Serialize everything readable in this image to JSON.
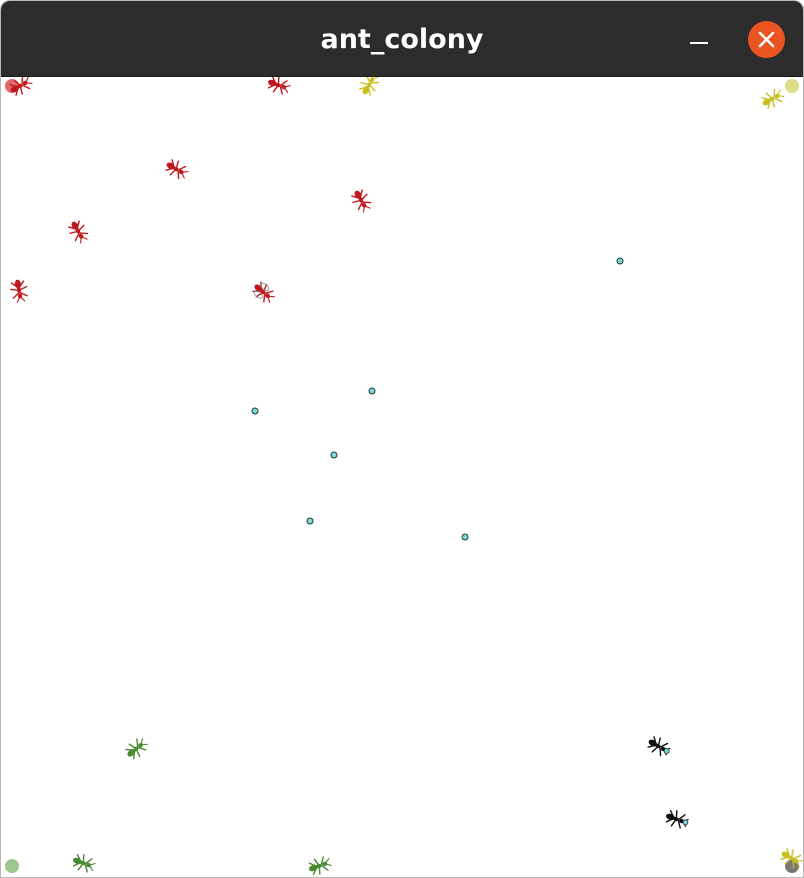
{
  "window": {
    "title": "ant_colony",
    "minimize_label": "minimize",
    "close_label": "close"
  },
  "colors": {
    "titlebar": "#2c2c2c",
    "close_button": "#e95420",
    "colony_red": "#c0181c",
    "colony_yellow": "#c8c020",
    "colony_green": "#4a8a30",
    "colony_black": "#111111",
    "food": "#7fd8d8",
    "nest_red": "#e06a6a",
    "nest_yellow": "#dede88",
    "nest_green": "#9cc78c",
    "nest_gray": "#777777"
  },
  "nests": [
    {
      "name": "nest-red",
      "color": "nest_red"
    },
    {
      "name": "nest-yellow",
      "color": "nest_yellow"
    },
    {
      "name": "nest-green",
      "color": "nest_green"
    },
    {
      "name": "nest-gray",
      "color": "nest_gray"
    }
  ],
  "colonies": [
    {
      "name": "red",
      "color": "colony_red",
      "ants": 7
    },
    {
      "name": "yellow",
      "color": "colony_yellow",
      "ants": 3
    },
    {
      "name": "green",
      "color": "colony_green",
      "ants": 3
    },
    {
      "name": "black",
      "color": "colony_black",
      "ants": 2
    }
  ],
  "food_items": 7
}
